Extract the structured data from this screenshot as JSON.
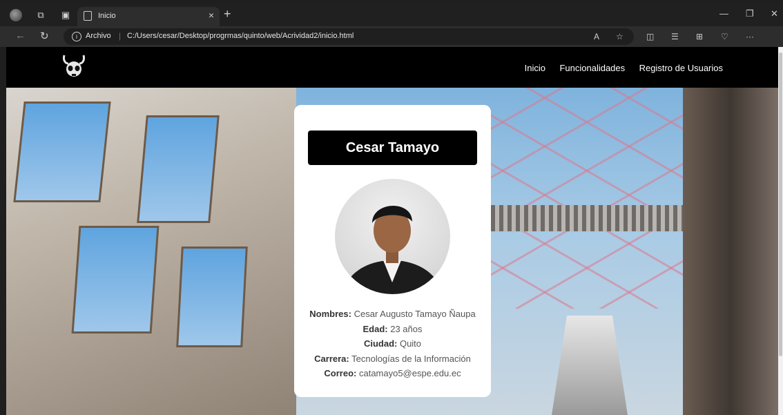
{
  "browser": {
    "tab_title": "Inicio",
    "new_tab": "+",
    "close_tab": "×",
    "scheme_label": "Archivo",
    "url": "C:/Users/cesar/Desktop/progrmas/quinto/web/Acrividad2/inicio.html",
    "icons": [
      "profile-icon",
      "workspaces-icon",
      "tab-actions-icon",
      "page-icon",
      "back-icon",
      "reload-icon",
      "info-icon",
      "read-aloud-icon",
      "favorite-star-icon",
      "split-screen-icon",
      "favorites-icon",
      "collections-icon",
      "browser-essentials-icon",
      "more-icon",
      "copilot-icon",
      "minimize-icon",
      "maximize-icon",
      "close-icon"
    ]
  },
  "site": {
    "nav": [
      "Inicio",
      "Funcionalidades",
      "Registro de Usuarios"
    ],
    "logo_icon": "horned-skull-logo"
  },
  "card": {
    "name": "Cesar Tamayo",
    "fields": [
      {
        "label": "Nombres:",
        "value": " Cesar Augusto Tamayo Ñaupa"
      },
      {
        "label": "Edad:",
        "value": " 23 años"
      },
      {
        "label": "Ciudad:",
        "value": " Quito"
      },
      {
        "label": "Carrera:",
        "value": " Tecnologías de la Información"
      },
      {
        "label": "Correo:",
        "value": " catamayo5@espe.edu.ec"
      }
    ]
  },
  "colors": {
    "header_bg": "#000000",
    "card_bg": "#ffffff",
    "name_box_bg": "#000000"
  }
}
